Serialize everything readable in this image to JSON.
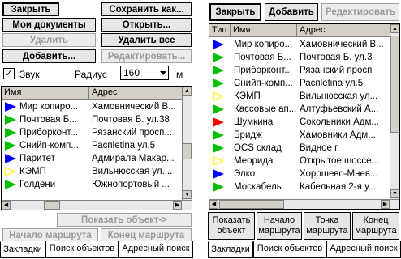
{
  "left": {
    "buttons": {
      "close": "Закрыть",
      "save_as": "Сохранить как...",
      "my_docs": "Мои документы",
      "open": "Открыть...",
      "delete": "Удалить",
      "delete_all": "Удалить все",
      "add": "Добавить...",
      "edit": "Редактировать..."
    },
    "sound_label": "Звук",
    "sound_checked": "✓",
    "radius_label": "Радиус",
    "radius_value": "160",
    "radius_unit": "м",
    "columns": [
      "Имя",
      "Адрес"
    ],
    "rows": [
      {
        "name": "Мир копиро...",
        "addr": "Хамовнический В...",
        "flag": "blue"
      },
      {
        "name": "Почтовая Б...",
        "addr": "Почтовая Б. ул.38",
        "flag": "green"
      },
      {
        "name": "Приборконт...",
        "addr": "Рязанский просп...",
        "flag": "green"
      },
      {
        "name": "Снийп-комп...",
        "addr": "Распletina ул.5",
        "flag": "green"
      },
      {
        "name": "Паритет",
        "addr": "Адмирала Макар...",
        "flag": "blue"
      },
      {
        "name": "КЭМП",
        "addr": "Вильнюсская ул....",
        "flag": "yellow"
      },
      {
        "name": "Голдени",
        "addr": "Южнопортовый ...",
        "flag": "green"
      }
    ],
    "show_object": "Показать объект->",
    "route_start": "Начало маршрута",
    "route_end": "Конец маршрута",
    "tabs": [
      "Закладки",
      "Поиск объектов",
      "Адресный поиск"
    ]
  },
  "right": {
    "buttons": {
      "close": "Закрыть",
      "add": "Добавить",
      "edit": "Редактировать"
    },
    "columns": [
      "Тип",
      "Имя",
      "Адрес"
    ],
    "rows": [
      {
        "name": "Мир копиро...",
        "addr": "Хамовнический В...",
        "flag": "blue"
      },
      {
        "name": "Почтовая Б...",
        "addr": "Почтовая Б. ул.3",
        "flag": "green"
      },
      {
        "name": "Приборконт...",
        "addr": "Рязанский просп",
        "flag": "green"
      },
      {
        "name": "Снийп-комп...",
        "addr": "Распletina ул.5",
        "flag": "green"
      },
      {
        "name": "КЭМП",
        "addr": "Вильнюсская ул...",
        "flag": "yellow"
      },
      {
        "name": "Кассовые ап...",
        "addr": "Алтуфьевский А...",
        "flag": "green"
      },
      {
        "name": "Шумкина",
        "addr": "Сокольники Адм...",
        "flag": "red"
      },
      {
        "name": "Бридж",
        "addr": "Хамовники Адм...",
        "flag": "green"
      },
      {
        "name": "OCS склад",
        "addr": "Видное г.",
        "flag": "green"
      },
      {
        "name": "Меорида",
        "addr": "Открытое шоссе...",
        "flag": "yellow"
      },
      {
        "name": "Элко",
        "addr": "Хорошево-Мнев...",
        "flag": "blue"
      },
      {
        "name": "Москабель",
        "addr": "Кабельная 2-я у...",
        "flag": "green"
      }
    ],
    "actions": [
      "Показать\nобъект",
      "Начало\nмаршрута",
      "Точка\nмаршрута",
      "Конец\nмаршрута"
    ],
    "tabs": [
      "Закладки",
      "Поиск объектов",
      "Адресный поиск"
    ]
  },
  "colors": {
    "blue": "#0000ff",
    "green": "#00c000",
    "yellow": "#ffff00",
    "red": "#ff0000"
  }
}
